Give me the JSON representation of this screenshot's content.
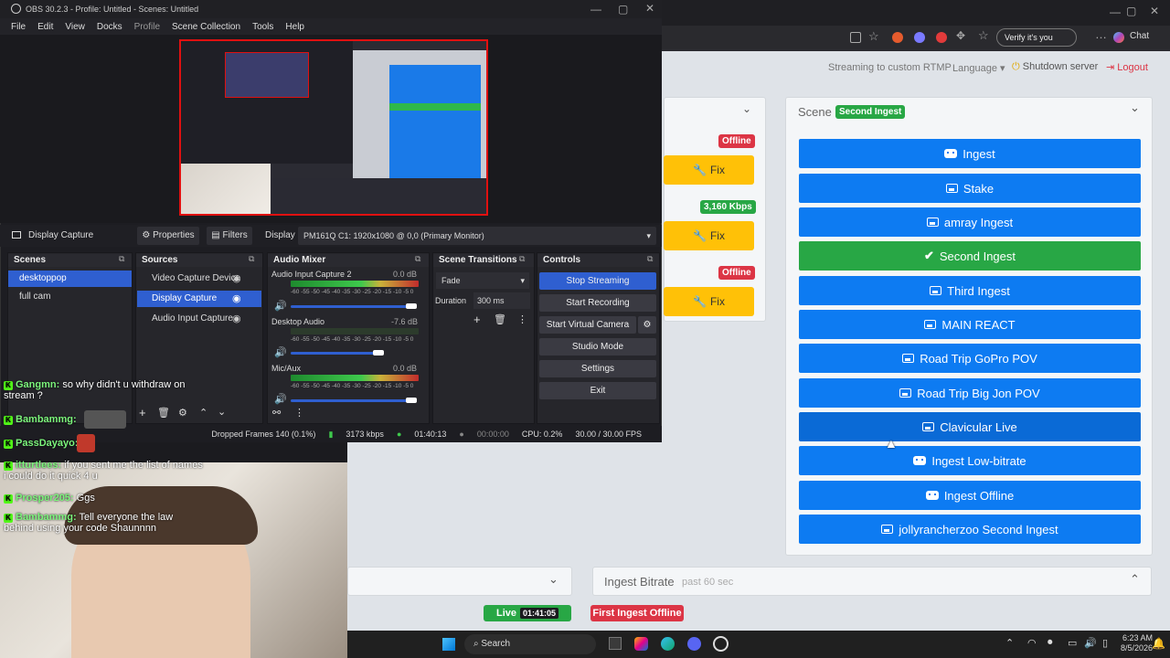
{
  "browser": {
    "toolbar": {
      "verify_label": "Verify it's you",
      "chat_label": "Chat"
    },
    "header": {
      "streaming_text": "Streaming to custom RTMP",
      "language_label": "Language",
      "shutdown_label": "Shutdown server",
      "logout_label": "Logout"
    },
    "ingests": {
      "badges": [
        "Offline",
        "3,160 Kbps",
        "Offline"
      ],
      "fix_label": "Fix"
    },
    "scene": {
      "label": "Scene",
      "current_badge": "Second Ingest",
      "buttons": [
        {
          "label": "Ingest",
          "icon": "robot-icon"
        },
        {
          "label": "Stake",
          "icon": "image-icon"
        },
        {
          "label": "amray Ingest",
          "icon": "image-icon"
        },
        {
          "label": "Second Ingest",
          "icon": "check-icon"
        },
        {
          "label": "Third Ingest",
          "icon": "image-icon"
        },
        {
          "label": "MAIN REACT",
          "icon": "image-icon"
        },
        {
          "label": "Road Trip GoPro POV",
          "icon": "image-icon"
        },
        {
          "label": "Road Trip Big Jon POV",
          "icon": "image-icon"
        },
        {
          "label": "Clavicular Live",
          "icon": "image-icon"
        },
        {
          "label": "Ingest Low-bitrate",
          "icon": "robot-icon"
        },
        {
          "label": "Ingest Offline",
          "icon": "robot-icon"
        },
        {
          "label": "jollyrancherzoo Second Ingest",
          "icon": "image-icon"
        }
      ]
    },
    "bitrate": {
      "title": "Ingest Bitrate",
      "subtitle": "past 60 sec"
    },
    "footer": {
      "live_label": "Live",
      "live_time": "01:41:05",
      "alert": "First Ingest Offline"
    }
  },
  "obs": {
    "title": "OBS 30.2.3 - Profile: Untitled - Scenes: Untitled",
    "menu": [
      "File",
      "Edit",
      "View",
      "Docks",
      "Profile",
      "Scene Collection",
      "Tools",
      "Help"
    ],
    "source_bar": {
      "name": "Display Capture",
      "properties": "Properties",
      "filters": "Filters",
      "display_label": "Display",
      "display_value": "PM161Q C1: 1920x1080 @ 0,0 (Primary Monitor)"
    },
    "scenes": {
      "title": "Scenes",
      "items": [
        "desktoppop",
        "full cam"
      ]
    },
    "sources": {
      "title": "Sources",
      "items": [
        "Video Capture Device",
        "Display Capture",
        "Audio Input Capture"
      ]
    },
    "mixer": {
      "title": "Audio Mixer",
      "channels": [
        {
          "name": "Audio Input Capture 2",
          "db": "0.0 dB"
        },
        {
          "name": "Desktop Audio",
          "db": "-7.6 dB"
        },
        {
          "name": "Mic/Aux",
          "db": "0.0 dB"
        }
      ],
      "scale": "-60 -55 -50 -45 -40 -35 -30 -25 -20 -15 -10 -5 0"
    },
    "transitions": {
      "title": "Scene Transitions",
      "type": "Fade",
      "duration_label": "Duration",
      "duration_value": "300 ms"
    },
    "controls": {
      "title": "Controls",
      "buttons": [
        "Stop Streaming",
        "Start Recording",
        "Start Virtual Camera",
        "Studio Mode",
        "Settings",
        "Exit"
      ]
    },
    "status": {
      "dropped": "Dropped Frames 140 (0.1%)",
      "kbps": "3173 kbps",
      "stream_time": "01:40:13",
      "rec_time": "00:00:00",
      "cpu": "CPU: 0.2%",
      "fps": "30.00 / 30.00 FPS"
    }
  },
  "chat": [
    {
      "user": "Gangmn:",
      "msg": "so why didn't u withdraw on stream ?"
    },
    {
      "user": "Bambammg:",
      "msg": ""
    },
    {
      "user": "PassDayayo:",
      "msg": ""
    },
    {
      "user": "itturtlees:",
      "msg": "if you sent me the list of names i could do it quick 4 u"
    },
    {
      "user": "Prosper205:",
      "msg": "Ggs"
    },
    {
      "user": "Bambammg:",
      "msg": "Tell everyone the law behind using your code Shaunnnn"
    }
  ],
  "taskbar": {
    "search_label": "Search",
    "time": "6:23 AM",
    "date": "8/5/2026"
  }
}
